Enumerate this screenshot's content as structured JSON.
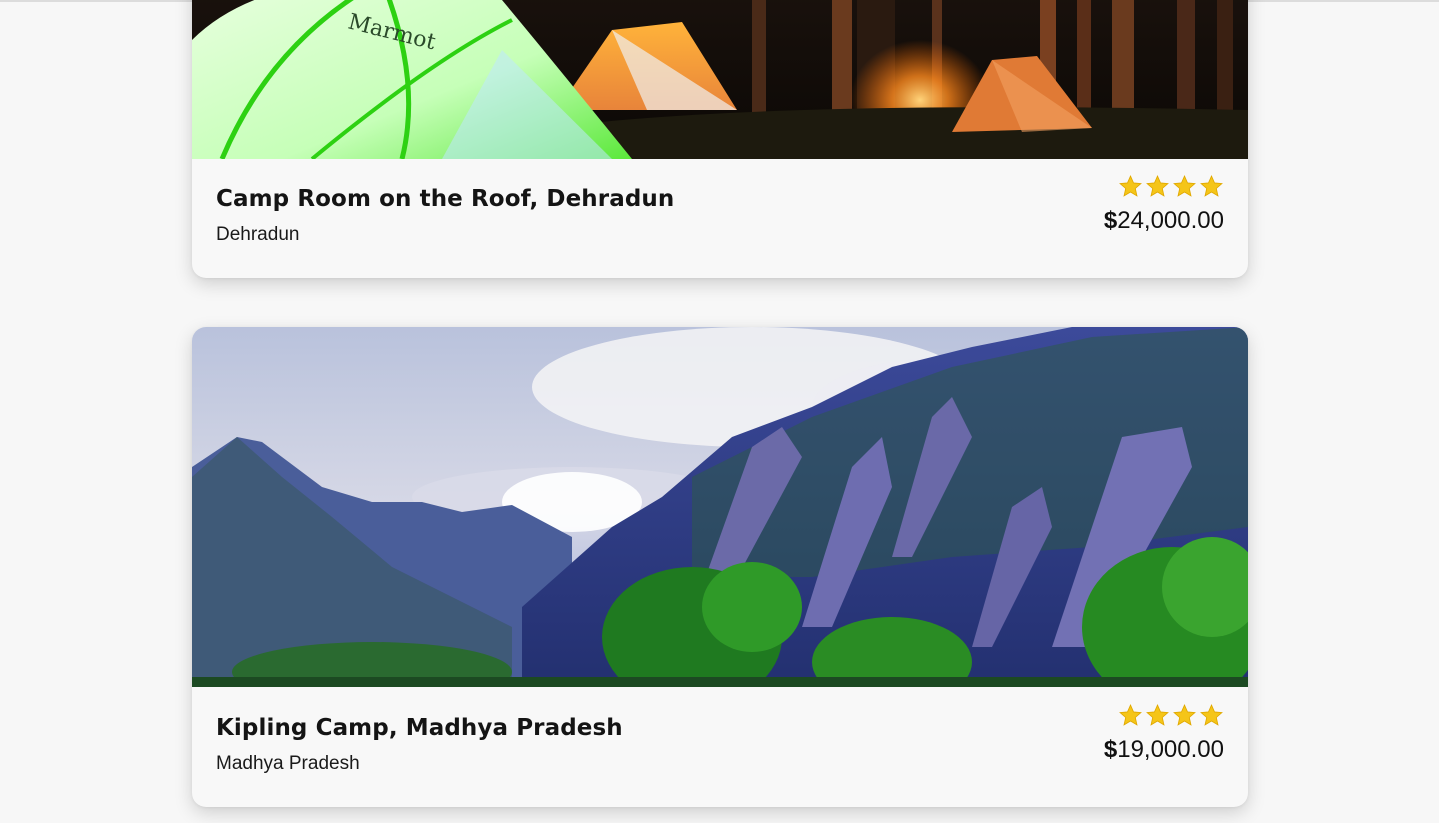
{
  "listings": [
    {
      "title": "Camp Room on the Roof, Dehradun",
      "location": "Dehradun",
      "rating": 4,
      "currency": "$",
      "price": "24,000.00",
      "image": "tent-camp-night-photo"
    },
    {
      "title": "Kipling Camp, Madhya Pradesh",
      "location": "Madhya Pradesh",
      "rating": 4,
      "currency": "$",
      "price": "19,000.00",
      "image": "mountain-forest-photo"
    }
  ],
  "colors": {
    "page_bg": "#f7f7f7",
    "card_bg": "#f8f8f8",
    "star": "#f5c518",
    "text": "#111111"
  }
}
